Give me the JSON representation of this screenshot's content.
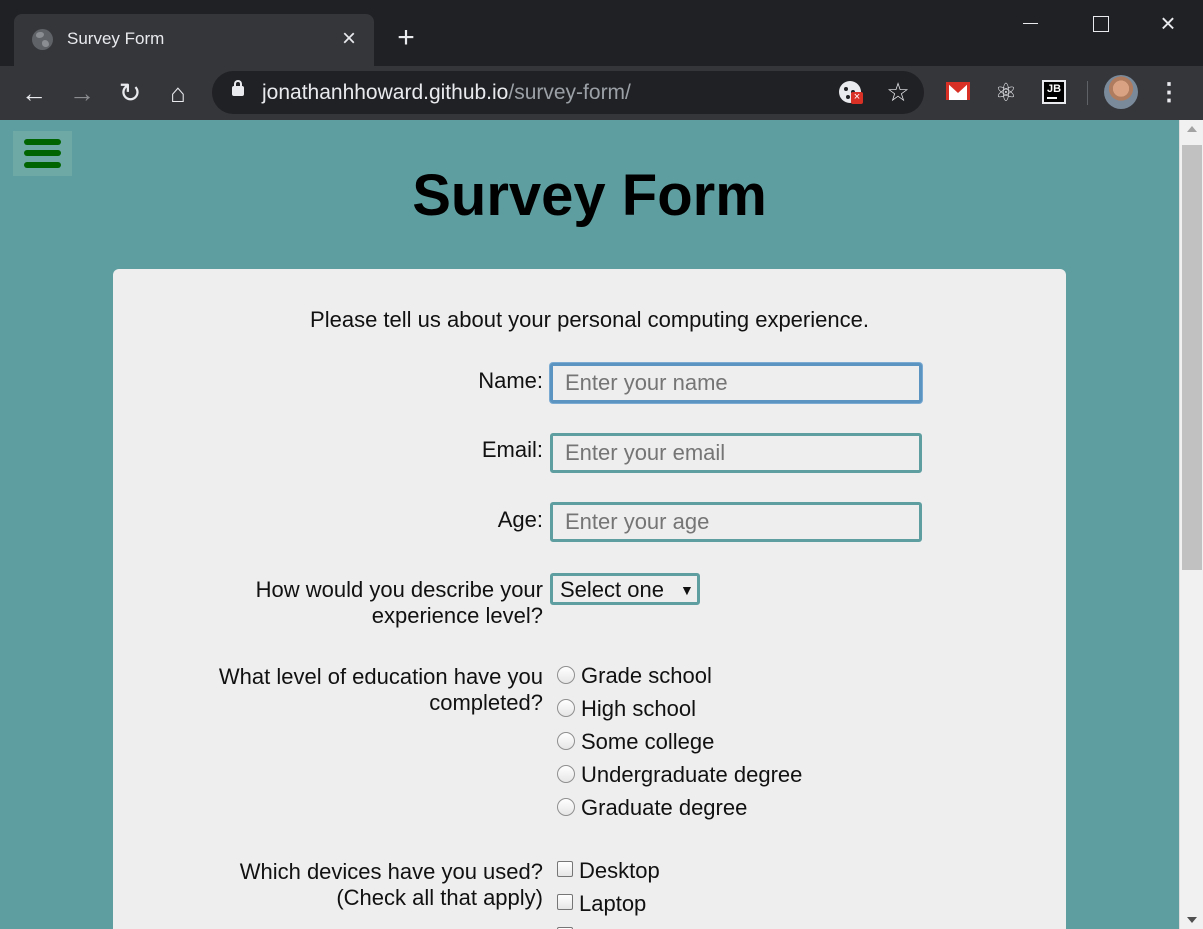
{
  "browser": {
    "tab_title": "Survey Form",
    "url_domain": "jonathanhhoward.github.io",
    "url_path": "/survey-form/"
  },
  "page": {
    "title": "Survey Form",
    "intro": "Please tell us about your personal computing experience.",
    "name": {
      "label": "Name:",
      "placeholder": "Enter your name"
    },
    "email": {
      "label": "Email:",
      "placeholder": "Enter your email"
    },
    "age": {
      "label": "Age:",
      "placeholder": "Enter your age"
    },
    "experience": {
      "label_line1": "How would you describe your",
      "label_line2": "experience level?",
      "selected": "Select one"
    },
    "education": {
      "label_line1": "What level of education have you",
      "label_line2": "completed?",
      "options": [
        "Grade school",
        "High school",
        "Some college",
        "Undergraduate degree",
        "Graduate degree"
      ]
    },
    "devices": {
      "label_line1": "Which devices have you used?",
      "label_line2": "(Check all that apply)",
      "options": [
        "Desktop",
        "Laptop"
      ]
    }
  },
  "colors": {
    "page_background": "#5f9ea0",
    "card_background": "#eeeeee",
    "hamburger_bars": "#006400",
    "input_border": "#5f9ea0",
    "focus_border": "#5b94c0"
  }
}
